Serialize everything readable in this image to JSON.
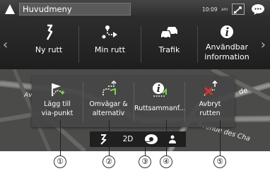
{
  "status_bar": {
    "title": "Huvudmeny",
    "clock": "10:09",
    "small_indicator": "am",
    "icons": [
      "navigation-arrow-icon",
      "signal-icon",
      "message-icon"
    ]
  },
  "top_menu": {
    "items": [
      {
        "label": "Ny rutt",
        "icon": "new-route-icon"
      },
      {
        "label": "Min rutt",
        "icon": "my-route-icon"
      },
      {
        "label": "Trafik",
        "icon": "traffic-icon"
      },
      {
        "label_line1": "Användbar",
        "label_line2": "information",
        "icon": "info-icon"
      }
    ],
    "left_arrow": "‹",
    "right_arrow": "›"
  },
  "map": {
    "street_text_1": "de",
    "street_text_2": "Avenue des Cha",
    "left_text": "Av"
  },
  "popup": {
    "items": [
      {
        "label_line1": "Lägg till",
        "label_line2": "via-punkt",
        "icon": "add-waypoint-icon"
      },
      {
        "label_line1": "Omvägar &",
        "label_line2": "alternativ",
        "icon": "detours-icon"
      },
      {
        "label_line1": "Ruttsammanf...",
        "label_line2": "",
        "icon": "route-summary-icon"
      },
      {
        "label_line1": "Avbryt",
        "label_line2": "rutten",
        "icon": "cancel-route-icon"
      }
    ]
  },
  "bottom_bar": {
    "mode_label": "2D",
    "icons": [
      "route-direction-icon",
      "compass-icon",
      "person-icon"
    ]
  },
  "callouts": [
    "①",
    "②",
    "③",
    "④",
    "⑤"
  ]
}
